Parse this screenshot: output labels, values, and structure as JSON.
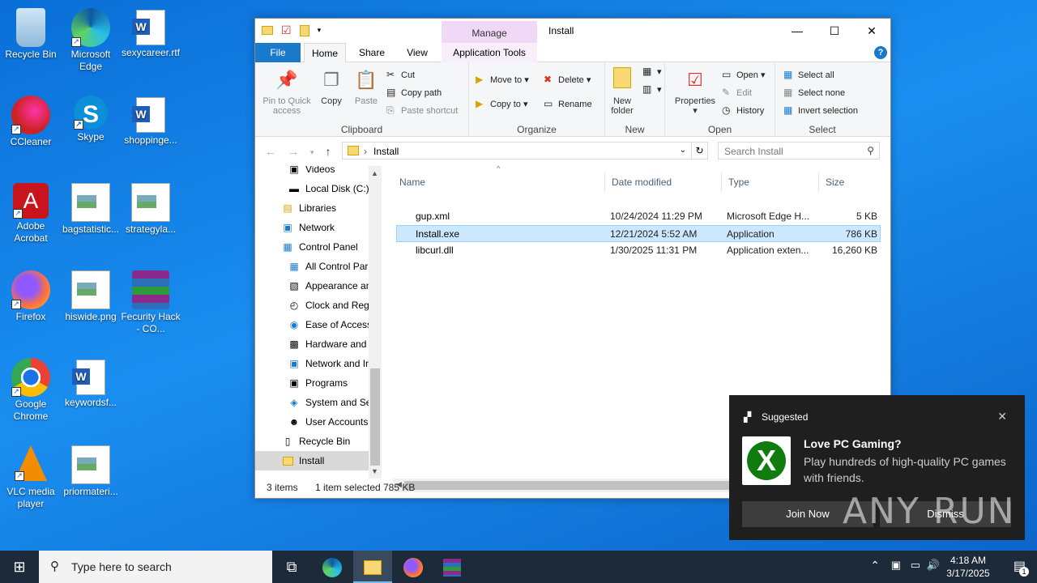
{
  "desktop": {
    "icons": [
      {
        "label": "Recycle Bin"
      },
      {
        "label": "Microsoft Edge"
      },
      {
        "label": "sexycareer.rtf"
      },
      {
        "label": "CCleaner"
      },
      {
        "label": "Skype"
      },
      {
        "label": "shoppinge..."
      },
      {
        "label": "Adobe Acrobat"
      },
      {
        "label": "bagstatistic..."
      },
      {
        "label": "strategyla..."
      },
      {
        "label": "Firefox"
      },
      {
        "label": "hiswide.png"
      },
      {
        "label": "Fecurity Hack - CO..."
      },
      {
        "label": "Google Chrome"
      },
      {
        "label": "keywordsf..."
      },
      {
        "label": "VLC media player"
      },
      {
        "label": "priormateri..."
      }
    ]
  },
  "window": {
    "title": "Install",
    "manage_tab": "Manage",
    "tabs": [
      "File",
      "Home",
      "Share",
      "View",
      "Application Tools"
    ],
    "ribbon": {
      "clipboard": {
        "label": "Clipboard",
        "pin": "Pin to Quick access",
        "copy": "Copy",
        "paste": "Paste",
        "cut": "Cut",
        "copy_path": "Copy path",
        "paste_shortcut": "Paste shortcut"
      },
      "organize": {
        "label": "Organize",
        "move_to": "Move to",
        "copy_to": "Copy to",
        "delete": "Delete",
        "rename": "Rename"
      },
      "new": {
        "label": "New",
        "new_folder": "New folder"
      },
      "open": {
        "label": "Open",
        "properties": "Properties",
        "open": "Open",
        "edit": "Edit",
        "history": "History"
      },
      "select": {
        "label": "Select",
        "select_all": "Select all",
        "select_none": "Select none",
        "invert": "Invert selection"
      }
    },
    "address": {
      "path": "Install",
      "search_placeholder": "Search Install"
    },
    "nav_items": [
      {
        "label": "Videos"
      },
      {
        "label": "Local Disk (C:)"
      },
      {
        "label": "Libraries"
      },
      {
        "label": "Network"
      },
      {
        "label": "Control Panel"
      },
      {
        "label": "All Control Par"
      },
      {
        "label": "Appearance an"
      },
      {
        "label": "Clock and Regi"
      },
      {
        "label": "Ease of Access"
      },
      {
        "label": "Hardware and"
      },
      {
        "label": "Network and Ir"
      },
      {
        "label": "Programs"
      },
      {
        "label": "System and Sec"
      },
      {
        "label": "User Accounts"
      },
      {
        "label": "Recycle Bin"
      },
      {
        "label": "Install"
      }
    ],
    "columns": {
      "name": "Name",
      "date": "Date modified",
      "type": "Type",
      "size": "Size"
    },
    "files": [
      {
        "name": "gup.xml",
        "date": "10/24/2024 11:29 PM",
        "type": "Microsoft Edge H...",
        "size": "5 KB"
      },
      {
        "name": "Install.exe",
        "date": "12/21/2024 5:52 AM",
        "type": "Application",
        "size": "786 KB"
      },
      {
        "name": "libcurl.dll",
        "date": "1/30/2025 11:31 PM",
        "type": "Application exten...",
        "size": "16,260 KB"
      }
    ],
    "status": {
      "items": "3 items",
      "selected": "1 item selected",
      "size": "785 KB"
    }
  },
  "toast": {
    "header": "Suggested",
    "title": "Love PC Gaming?",
    "body": "Play hundreds of high-quality PC games with friends.",
    "join": "Join Now",
    "dismiss": "Dismiss"
  },
  "taskbar": {
    "search_placeholder": "Type here to search",
    "time": "4:18 AM",
    "date": "3/17/2025",
    "notif_count": "1"
  },
  "watermark": "ANY RUN"
}
